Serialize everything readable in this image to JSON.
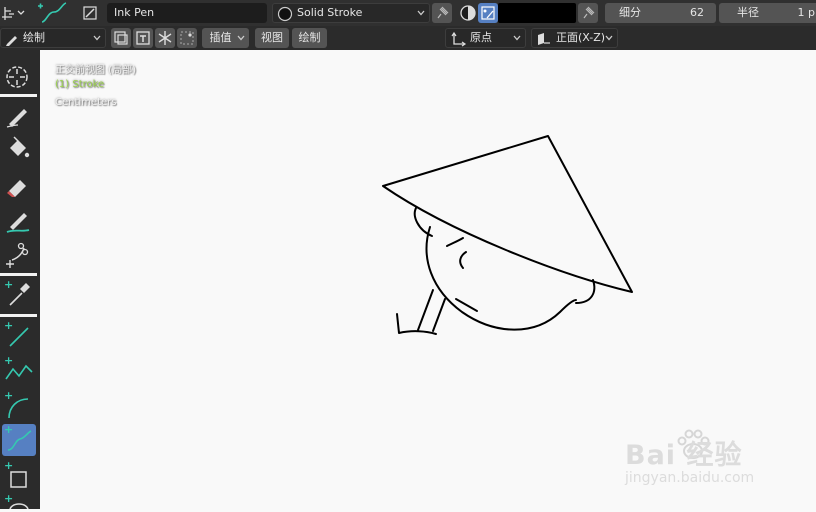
{
  "header": {
    "brush_name": "Ink Pen",
    "material_name": "Solid Stroke",
    "subdivisions_label": "细分",
    "subdivisions_value": "62",
    "radius_label": "半径",
    "radius_value": "1 p"
  },
  "toolbar2": {
    "mode_label": "绘制",
    "interpolate_label": "插值",
    "view_label": "视图",
    "draw_label": "绘制",
    "origin_label": "原点",
    "plane_label": "正面(X-Z)"
  },
  "viewport": {
    "view_name": "正交前视图 (局部)",
    "object_info": "(1) Stroke",
    "units": "Centimeters"
  },
  "watermark": {
    "brand": "Bai 经验",
    "url": "jingyan.baidu.com"
  },
  "colors": {
    "active_tool": "#5680c2",
    "object_info": "#9bd24e",
    "accent_plus": "#35c9b0"
  },
  "tools": [
    "cursor-icon",
    "draw-pen-icon",
    "fill-bucket-icon",
    "eraser-icon",
    "tint-brush-icon",
    "cutter-icon",
    "eyedropper-icon",
    "line-icon",
    "polyline-icon",
    "arc-icon",
    "curve-icon",
    "box-icon",
    "circle-icon"
  ]
}
